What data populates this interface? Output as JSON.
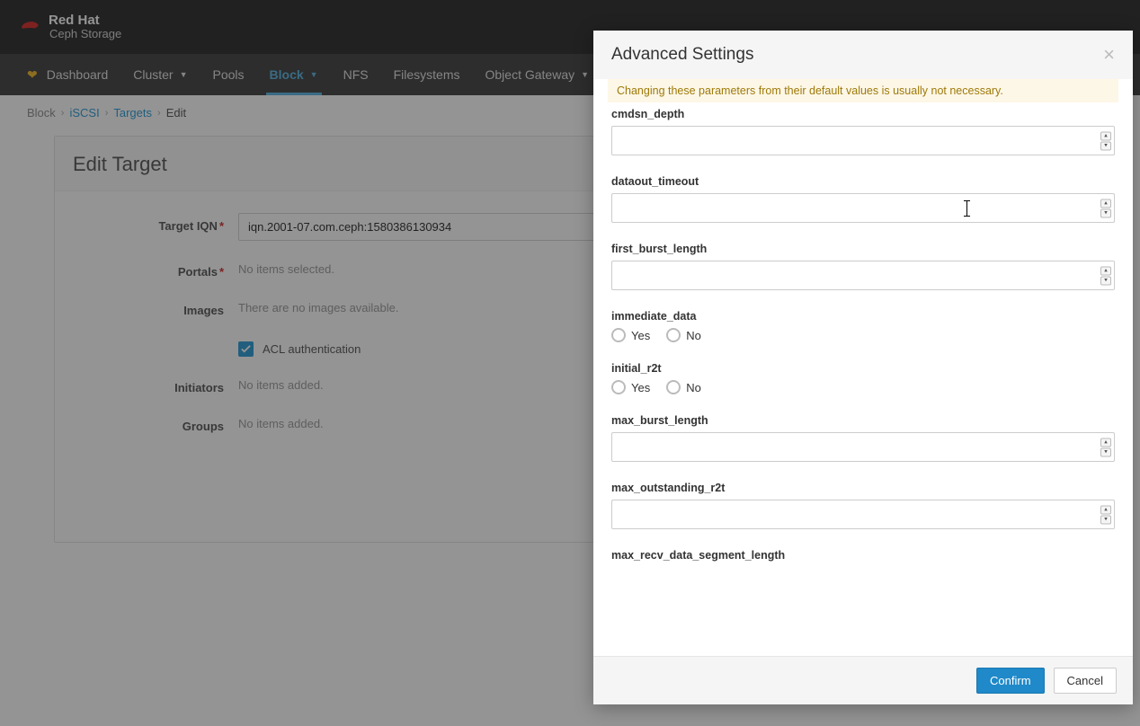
{
  "brand": {
    "top": "Red Hat",
    "bottom": "Ceph Storage"
  },
  "nav": {
    "dashboard": "Dashboard",
    "cluster": "Cluster",
    "pools": "Pools",
    "block": "Block",
    "nfs": "NFS",
    "filesystems": "Filesystems",
    "object_gateway": "Object Gateway"
  },
  "breadcrumb": {
    "block": "Block",
    "iscsi": "iSCSI",
    "targets": "Targets",
    "edit": "Edit"
  },
  "panel": {
    "title": "Edit Target",
    "labels": {
      "target_iqn": "Target IQN",
      "portals": "Portals",
      "images": "Images",
      "initiators": "Initiators",
      "groups": "Groups"
    },
    "target_iqn_value": "iqn.2001-07.com.ceph:1580386130934",
    "portals_placeholder": "No items selected.",
    "images_placeholder": "There are no images available.",
    "acl_label": "ACL authentication",
    "initiators_placeholder": "No items added.",
    "groups_placeholder": "No items added."
  },
  "modal": {
    "title": "Advanced Settings",
    "warning": "Changing these parameters from their default values is usually not necessary.",
    "fields": {
      "cmdsn_depth": "cmdsn_depth",
      "dataout_timeout": "dataout_timeout",
      "first_burst_length": "first_burst_length",
      "immediate_data": "immediate_data",
      "initial_r2t": "initial_r2t",
      "max_burst_length": "max_burst_length",
      "max_outstanding_r2t": "max_outstanding_r2t",
      "max_recv_data_segment_length": "max_recv_data_segment_length"
    },
    "yes": "Yes",
    "no": "No",
    "confirm": "Confirm",
    "cancel": "Cancel"
  }
}
